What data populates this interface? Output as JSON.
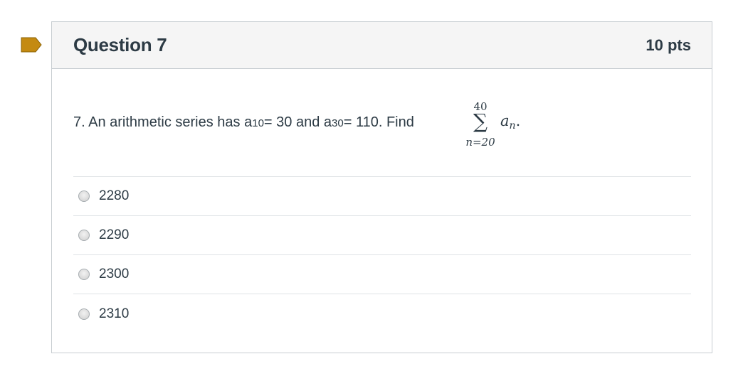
{
  "colors": {
    "flag": "#c48a11",
    "header_bg": "#f5f5f5",
    "border": "#c7cdd1",
    "text": "#2d3b45"
  },
  "flag": {
    "icon": "bookmark-flag-icon"
  },
  "question": {
    "title": "Question 7",
    "points": "10 pts",
    "text": {
      "prefix": "7. An arithmetic series has a",
      "sub1": "10",
      "mid1": " = 30 and a",
      "sub2": "30",
      "mid2": " = 110. Find",
      "sum_upper": "40",
      "sum_symbol": "∑",
      "sum_lower": "n=20",
      "term": "a",
      "term_sub": "n",
      "term_end": "."
    },
    "answers": [
      {
        "label": "2280",
        "selected": false
      },
      {
        "label": "2290",
        "selected": false
      },
      {
        "label": "2300",
        "selected": false
      },
      {
        "label": "2310",
        "selected": false
      }
    ]
  }
}
